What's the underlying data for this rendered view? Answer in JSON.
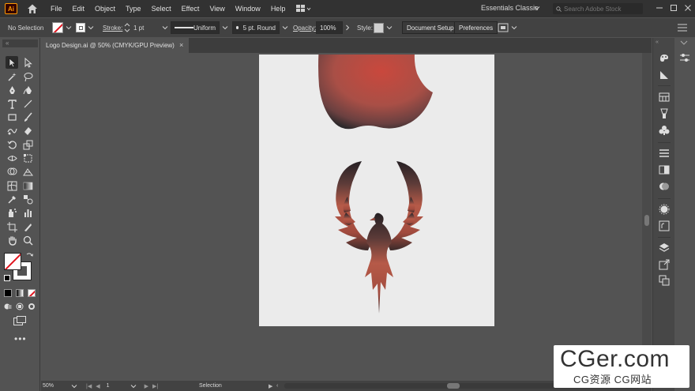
{
  "app": {
    "logo": "Ai"
  },
  "menu": [
    "File",
    "Edit",
    "Object",
    "Type",
    "Select",
    "Effect",
    "View",
    "Window",
    "Help"
  ],
  "workspace": "Essentials Classic",
  "search": {
    "placeholder": "Search Adobe Stock"
  },
  "control": {
    "selection": "No Selection",
    "stroke_label": "Stroke:",
    "stroke_value": "1 pt",
    "profile": "Uniform",
    "brush": "5 pt. Round",
    "opacity_label": "Opacity:",
    "opacity_value": "100%",
    "style_label": "Style:",
    "document_setup": "Document Setup",
    "preferences": "Preferences"
  },
  "tab": {
    "title": "Logo Design.ai @ 50% (CMYK/GPU Preview)",
    "close": "×"
  },
  "status": {
    "zoom": "50%",
    "artboard": "1",
    "tool": "Selection"
  },
  "watermark": {
    "logo": "CGer.com",
    "sub": "CG资源  CG网站"
  },
  "colors": {
    "menubar": "#323232",
    "panel": "#535353",
    "artboard": "#ebebeb",
    "accent": "#ff9a00",
    "logo_red": "#c05a48",
    "logo_dark": "#2d2525"
  },
  "tools": [
    "selection-tool",
    "direct-selection-tool",
    "magic-wand-tool",
    "lasso-tool",
    "pen-tool",
    "curvature-tool",
    "type-tool",
    "line-tool",
    "rectangle-tool",
    "paintbrush-tool",
    "shaper-tool",
    "eraser-tool",
    "rotate-tool",
    "scale-tool",
    "width-tool",
    "free-transform-tool",
    "shape-builder-tool",
    "perspective-tool",
    "mesh-tool",
    "gradient-tool",
    "eyedropper-tool",
    "blend-tool",
    "symbol-sprayer-tool",
    "column-graph-tool",
    "artboard-tool",
    "slice-tool",
    "hand-tool",
    "zoom-tool"
  ]
}
